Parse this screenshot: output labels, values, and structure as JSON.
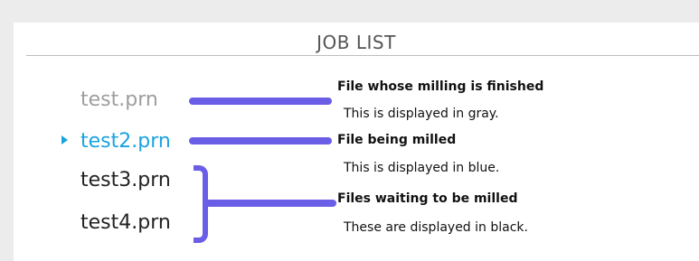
{
  "header": {
    "title": "JOB LIST"
  },
  "jobs": [
    {
      "name": "test.prn",
      "state": "finished",
      "color": "#9e9e9e"
    },
    {
      "name": "test2.prn",
      "state": "milling",
      "color": "#1aa3e0"
    },
    {
      "name": "test3.prn",
      "state": "waiting",
      "color": "#222222"
    },
    {
      "name": "test4.prn",
      "state": "waiting",
      "color": "#222222"
    }
  ],
  "annotations": [
    {
      "title": "File whose milling is finished",
      "desc": "This is displayed in gray."
    },
    {
      "title": "File being milled",
      "desc": "This is displayed in blue."
    },
    {
      "title": "Files waiting to be milled",
      "desc": "These are displayed in black."
    }
  ],
  "colors": {
    "annotation_accent": "#6a5ee6",
    "active_marker": "#1aa3e0"
  },
  "icons": {
    "active_marker": "play-triangle-icon"
  }
}
